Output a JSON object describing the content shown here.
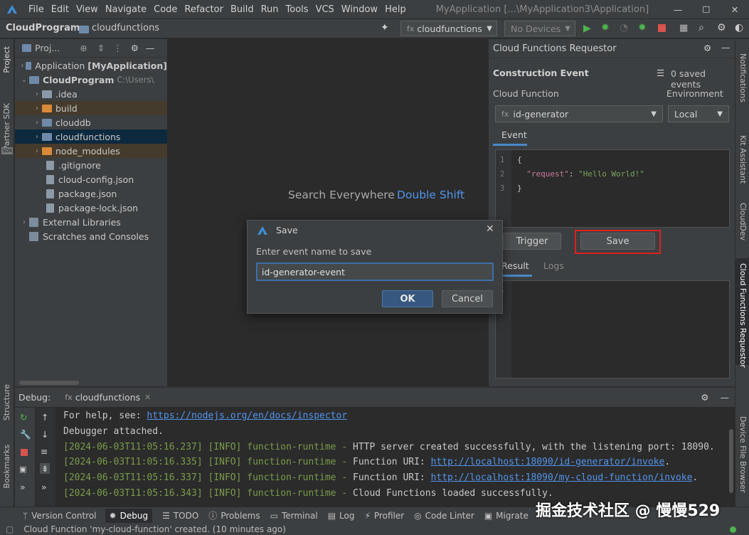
{
  "menubar": {
    "items": [
      "File",
      "Edit",
      "View",
      "Navigate",
      "Code",
      "Refactor",
      "Build",
      "Run",
      "Tools",
      "VCS",
      "Window",
      "Help"
    ],
    "window_title": "MyApplication [...\\MyApplication3\\Application]"
  },
  "navbar": {
    "breadcrumb_root": "CloudProgram",
    "breadcrumb_child": "cloudfunctions",
    "run_config": "cloudfunctions",
    "device": "No Devices"
  },
  "left_strip": {
    "project": "Project",
    "partner_sdk": "Partner SDK",
    "sdk_badge": "SDK",
    "structure": "Structure",
    "bookmarks": "Bookmarks"
  },
  "right_strip": {
    "notifications": "Notifications",
    "kit_assistant": "Kit Assistant",
    "clouddev": "CloudDev",
    "cf_requestor": "Cloud Functions Requestor",
    "device_file": "Device File Browser"
  },
  "project": {
    "header": "Proj...",
    "tree": [
      {
        "label": "Application",
        "bold": "[MyApplication]"
      },
      {
        "label": "CloudProgram",
        "path": "C:\\Users\\"
      },
      {
        "label": ".idea"
      },
      {
        "label": "build"
      },
      {
        "label": "clouddb"
      },
      {
        "label": "cloudfunctions"
      },
      {
        "label": "node_modules"
      },
      {
        "label": ".gitignore"
      },
      {
        "label": "cloud-config.json"
      },
      {
        "label": "package.json"
      },
      {
        "label": "package-lock.json"
      },
      {
        "label": "External Libraries"
      },
      {
        "label": "Scratches and Consoles"
      }
    ]
  },
  "editor": {
    "hint_label": "Search Everywhere",
    "hint_shortcut": "Double Shift"
  },
  "cf_panel": {
    "title": "Cloud Functions Requestor",
    "construction_event": "Construction Event",
    "saved_events": "0 saved events",
    "cloud_function_label": "Cloud Function",
    "environment_label": "Environment",
    "function_value": "id-generator",
    "environment_value": "Local",
    "event_tab": "Event",
    "code_lines": [
      "1",
      "2",
      "3"
    ],
    "code_open": "{",
    "code_key": "\"request\"",
    "code_colon": ": ",
    "code_value": "\"Hello World!\"",
    "code_close": "}",
    "trigger_button": "Trigger",
    "save_button": "Save",
    "result_tab": "Result",
    "logs_tab": "Logs",
    "result_line": "1"
  },
  "dialog": {
    "title": "Save",
    "prompt": "Enter event name to save",
    "input_value": "id-generator-event",
    "ok": "OK",
    "cancel": "Cancel"
  },
  "debug": {
    "label": "Debug:",
    "tab": "cloudfunctions",
    "lines": [
      {
        "prefix": "For help, see: ",
        "link": "https://nodejs.org/en/docs/inspector"
      },
      {
        "text": "Debugger attached."
      },
      {
        "ts": "[2024-06-03T11:05:16.237] [INFO] function-runtime - ",
        "text": "HTTP server created successfully, with the listening port: 18090."
      },
      {
        "ts": "[2024-06-03T11:05:16.335] [INFO] function-runtime - ",
        "text": "Function URI: ",
        "link": "http://localhost:18090/id-generator/invoke",
        "suffix": "."
      },
      {
        "ts": "[2024-06-03T11:05:16.337] [INFO] function-runtime - ",
        "text": "Function URI: ",
        "link": "http://localhost:18090/my-cloud-function/invoke",
        "suffix": "."
      },
      {
        "ts": "[2024-06-03T11:05:16.343] [INFO] function-runtime - ",
        "text": "Cloud Functions loaded successfully."
      }
    ]
  },
  "bottom_tabs": [
    "Version Control",
    "Debug",
    "TODO",
    "Problems",
    "Terminal",
    "Log",
    "Profiler",
    "Code Linter",
    "Migrate"
  ],
  "status": "Cloud Function 'my-cloud-function' created. (10 minutes ago)",
  "watermark": "掘金技术社区 @ 慢慢529",
  "colors": {
    "accent": "#5394ec",
    "highlight_box": "#e02020",
    "selection": "#0d293e"
  }
}
